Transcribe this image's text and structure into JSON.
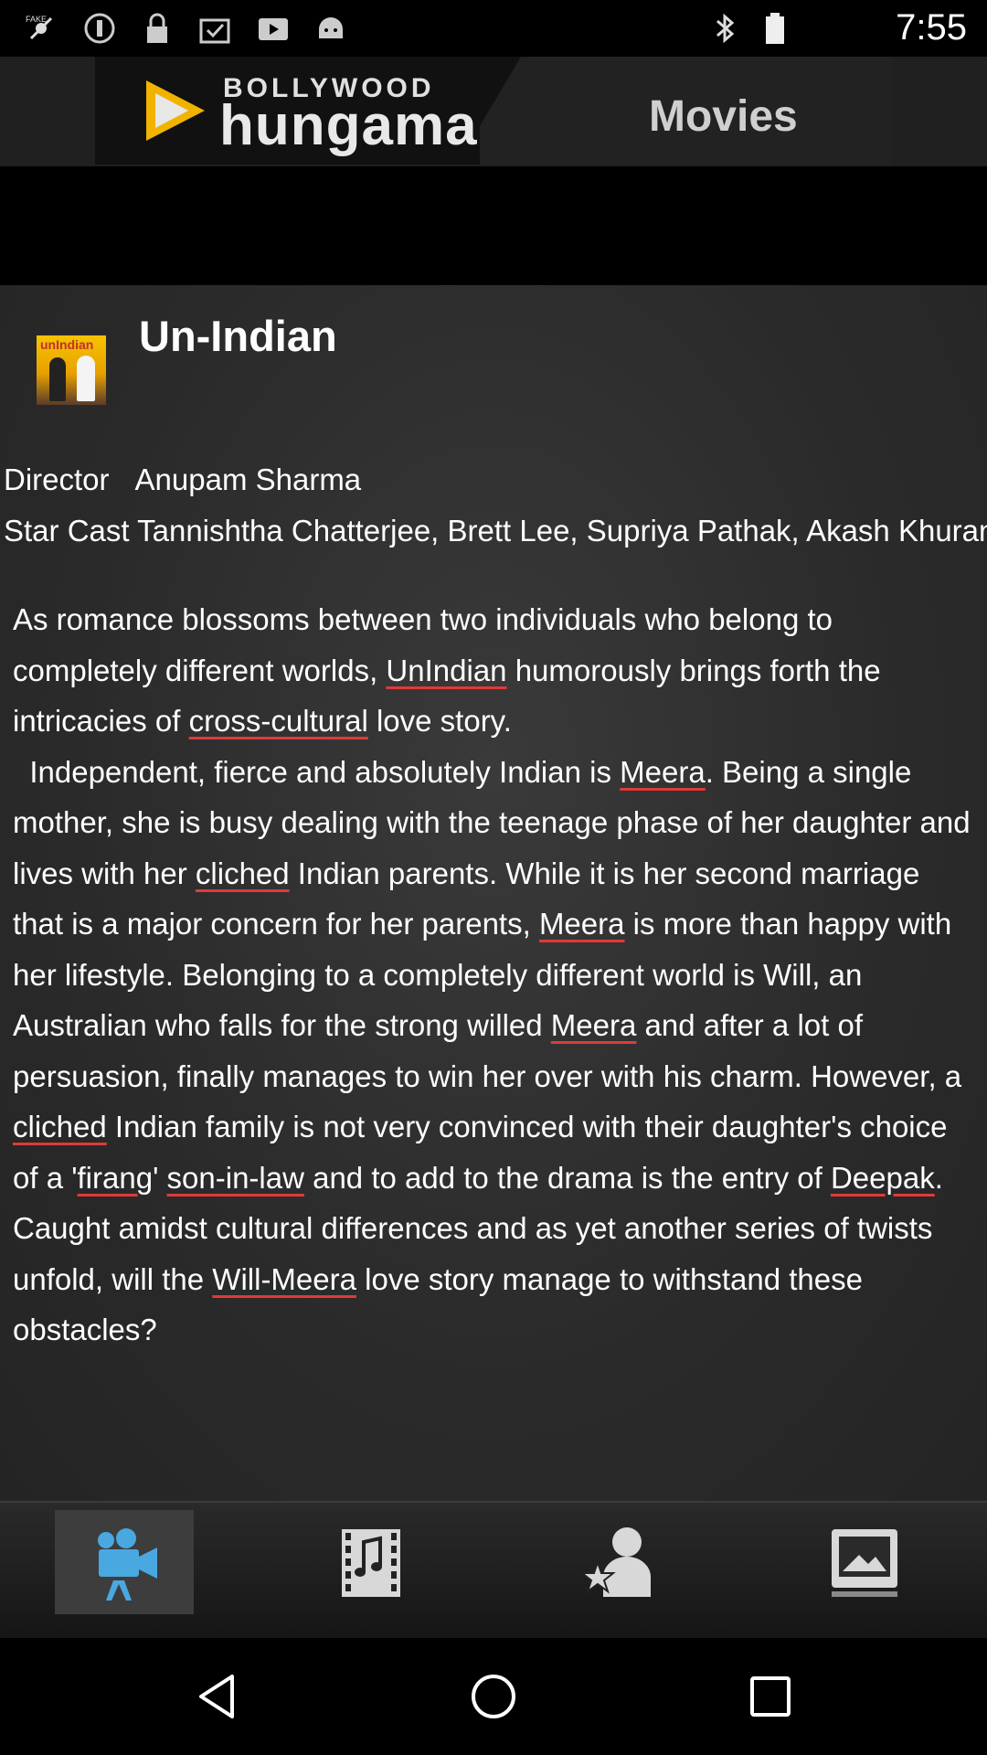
{
  "status_bar": {
    "time": "7:55",
    "icons": [
      "fake-gps-icon",
      "do-not-disturb-icon",
      "lock-icon",
      "clipboard-check-icon",
      "youtube-icon",
      "android-icon",
      "bluetooth-icon",
      "battery-icon"
    ]
  },
  "header": {
    "brand_top": "BOLLYWOOD",
    "brand_main": "hungama",
    "section": "Movies"
  },
  "movie": {
    "title": "Un-Indian",
    "poster_text": "unIndian",
    "director_label": "Director",
    "director": "Anupam Sharma",
    "cast_label": "Star Cast",
    "cast": "Tannishtha Chatterjee, Brett Lee, Supriya Pathak, Akash Khurana"
  },
  "synopsis": {
    "p1a": "As romance blossoms between two individuals who belong to completely different worlds, ",
    "p1b": "UnIndian",
    "p1c": " humorously brings forth the intricacies of ",
    "p1d": "cross-cultural",
    "p1e": " love story.",
    "p2a": "Independent, fierce and absolutely Indian is ",
    "p2b": "Meera",
    "p2c": ". Being a single mother, she is busy dealing with the teenage phase of her daughter and lives with her ",
    "p2d": "cliched",
    "p2e": " Indian parents. While it is her second marriage that is a major concern for her parents, ",
    "p2f": "Meera",
    "p2g": " is more than happy with her lifestyle. Belonging to a completely different world is Will, an Australian who falls for the strong willed ",
    "p2h": "Meera",
    "p2i": " and after a lot of persuasion, finally manages to win her over with his charm. However, a ",
    "p2j": "cliched",
    "p2k": " Indian family is not very convinced with their daughter's choice of a '",
    "p2l": "firang",
    "p2m": "' ",
    "p2n": "son-in-law",
    "p2o": " and to add to the drama is the entry of ",
    "p2p": "Deepak",
    "p2q": ". Caught amidst cultural differences and as yet another series of twists unfold, will the ",
    "p2r": "Will-Meera",
    "p2s": " love story manage to withstand these obstacles?"
  },
  "tabs": [
    {
      "icon": "movie-camera-icon",
      "active": true
    },
    {
      "icon": "music-film-icon",
      "active": false
    },
    {
      "icon": "star-person-icon",
      "active": false
    },
    {
      "icon": "photo-gallery-icon",
      "active": false
    }
  ],
  "nav": [
    "back-icon",
    "home-icon",
    "recents-icon"
  ],
  "colors": {
    "spell_underline": "#e03a3a",
    "content_bg": "#2e2e2e",
    "tab_active_bg": "#3d3d3d",
    "tab_icon_active": "#4aa8e0",
    "tab_icon": "#e0e0e0"
  }
}
